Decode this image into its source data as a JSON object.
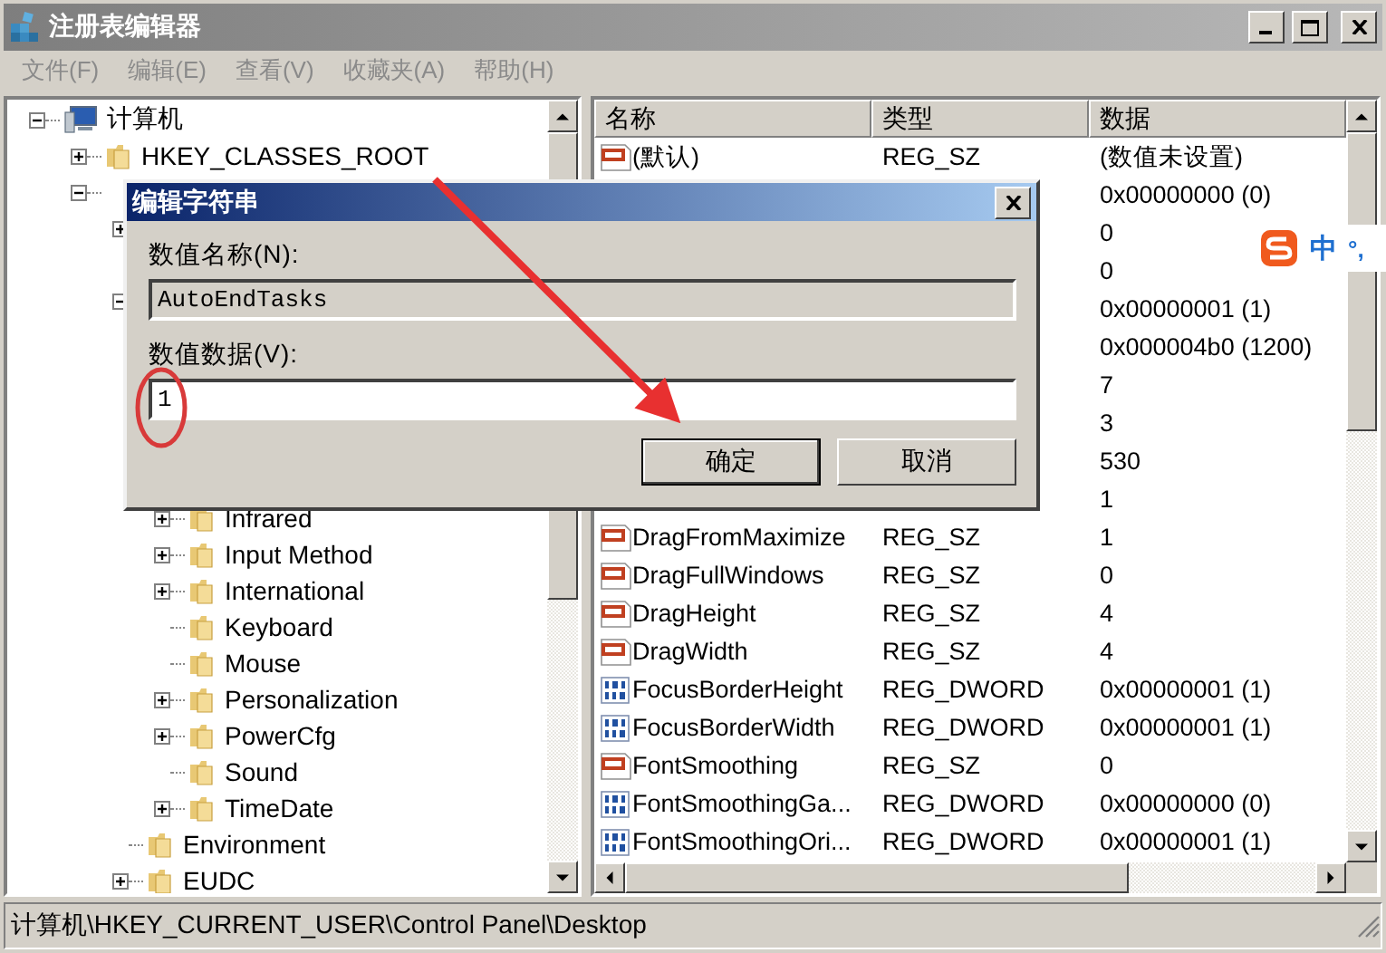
{
  "window": {
    "title": "注册表编辑器"
  },
  "menu": [
    {
      "label": "文件(F)",
      "disabled": true
    },
    {
      "label": "编辑(E)",
      "disabled": true
    },
    {
      "label": "查看(V)",
      "disabled": true
    },
    {
      "label": "收藏夹(A)",
      "disabled": true
    },
    {
      "label": "帮助(H)",
      "disabled": true
    }
  ],
  "tree": {
    "items": [
      {
        "kind": "computer",
        "label": "计算机",
        "expanded": true,
        "children": [
          {
            "kind": "key",
            "label": "HKEY_CLASSES_ROOT",
            "expanded": false
          },
          {
            "kind": "covered",
            "expanded": true,
            "children": [
              {
                "kind": "covered",
                "expanded": false
              },
              {
                "kind": "covered"
              },
              {
                "kind": "covered",
                "expanded": true,
                "children": [
                  {
                    "kind": "covered"
                  },
                  {
                    "kind": "covered"
                  },
                  {
                    "kind": "covered"
                  },
                  {
                    "kind": "covered"
                  },
                  {
                    "kind": "covered"
                  },
                  {
                    "kind": "key",
                    "label": "Infrared",
                    "expanded": false
                  },
                  {
                    "kind": "key",
                    "label": "Input Method",
                    "expanded": false
                  },
                  {
                    "kind": "key",
                    "label": "International",
                    "expanded": false
                  },
                  {
                    "kind": "key",
                    "label": "Keyboard"
                  },
                  {
                    "kind": "key",
                    "label": "Mouse"
                  },
                  {
                    "kind": "key",
                    "label": "Personalization",
                    "expanded": false
                  },
                  {
                    "kind": "key",
                    "label": "PowerCfg",
                    "expanded": false
                  },
                  {
                    "kind": "key",
                    "label": "Sound"
                  },
                  {
                    "kind": "key",
                    "label": "TimeDate",
                    "expanded": false
                  }
                ]
              },
              {
                "kind": "key",
                "label": "Environment"
              },
              {
                "kind": "key",
                "label": "EUDC",
                "expanded": false
              }
            ]
          }
        ]
      }
    ]
  },
  "list": {
    "columns": [
      "名称",
      "类型",
      "数据"
    ],
    "rows": [
      {
        "kind": "sz",
        "name": "(默认)",
        "type": "REG_SZ",
        "data": "(数值未设置)"
      },
      {
        "kind": "covered",
        "data": "0x00000000 (0)"
      },
      {
        "kind": "covered",
        "data": "0"
      },
      {
        "kind": "covered",
        "data": "0"
      },
      {
        "kind": "covered",
        "data": "0x00000001 (1)"
      },
      {
        "kind": "covered",
        "data": "0x000004b0 (1200)"
      },
      {
        "kind": "covered",
        "data": "7"
      },
      {
        "kind": "covered",
        "data": "3"
      },
      {
        "kind": "covered",
        "data": "530"
      },
      {
        "kind": "covered",
        "data": "1"
      },
      {
        "kind": "sz",
        "name": "DragFromMaximize",
        "type": "REG_SZ",
        "data": "1"
      },
      {
        "kind": "sz",
        "name": "DragFullWindows",
        "type": "REG_SZ",
        "data": "0"
      },
      {
        "kind": "sz",
        "name": "DragHeight",
        "type": "REG_SZ",
        "data": "4"
      },
      {
        "kind": "sz",
        "name": "DragWidth",
        "type": "REG_SZ",
        "data": "4"
      },
      {
        "kind": "dword",
        "name": "FocusBorderHeight",
        "type": "REG_DWORD",
        "data": "0x00000001 (1)"
      },
      {
        "kind": "dword",
        "name": "FocusBorderWidth",
        "type": "REG_DWORD",
        "data": "0x00000001 (1)"
      },
      {
        "kind": "sz",
        "name": "FontSmoothing",
        "type": "REG_SZ",
        "data": "0"
      },
      {
        "kind": "dword",
        "name": "FontSmoothingGa...",
        "type": "REG_DWORD",
        "data": "0x00000000 (0)"
      },
      {
        "kind": "dword",
        "name": "FontSmoothingOri...",
        "type": "REG_DWORD",
        "data": "0x00000001 (1)"
      }
    ]
  },
  "dialog": {
    "title": "编辑字符串",
    "fields": [
      {
        "label": "数值名称(N):",
        "value": "AutoEndTasks",
        "readonly": true
      },
      {
        "label": "数值数据(V):",
        "value": "1",
        "readonly": false
      }
    ],
    "buttons": [
      {
        "label": "确定",
        "default": true
      },
      {
        "label": "取消",
        "default": false
      }
    ]
  },
  "ime": {
    "mode": "中",
    "punctuation": "°,"
  },
  "status_bar": "计算机\\HKEY_CURRENT_USER\\Control Panel\\Desktop"
}
